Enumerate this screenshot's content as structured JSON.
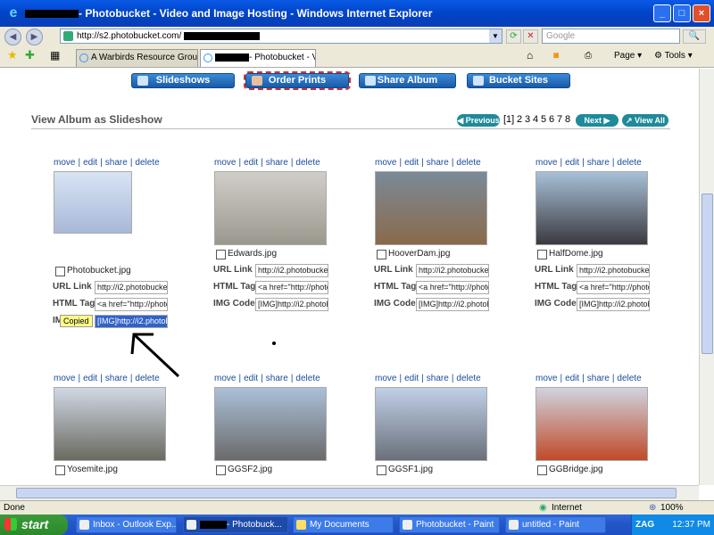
{
  "window": {
    "title": "- Photobucket - Video and Image Hosting - Windows Internet Explorer",
    "address": "http://s2.photobucket.com/",
    "search_placeholder": "Google"
  },
  "tabs": [
    {
      "label": "A Warbirds Resource Group ..."
    },
    {
      "label": "- Photobucket - V..."
    }
  ],
  "toolbar": {
    "page": "Page",
    "tools": "Tools"
  },
  "nav": {
    "slideshows": "Slideshows",
    "order_prints": "Order Prints",
    "share_album": "Share Album",
    "bucket_sites": "Bucket Sites"
  },
  "album": {
    "view_title": "View Album as Slideshow",
    "prev": "Previous",
    "current": "[1]",
    "pages": [
      "2",
      "3",
      "4",
      "5",
      "6",
      "7",
      "8"
    ],
    "next": "Next",
    "view_all": "View All"
  },
  "labels": {
    "url_link": "URL Link",
    "html_tag": "HTML Tag",
    "img_code": "IMG Code",
    "copied": "Copied",
    "img_code_partial": "IM"
  },
  "actions": {
    "move": "move",
    "edit": "edit",
    "share": "share",
    "delete": "delete",
    "sep": "|"
  },
  "photos": [
    {
      "name": "Photobucket.jpg",
      "url": "http://i2.photobucke",
      "html": "<a href=\"http://photo",
      "img": "[IMG]http://i2.photob"
    },
    {
      "name": "Edwards.jpg",
      "url": "http://i2.photobucke",
      "html": "<a href=\"http://photo",
      "img": "[IMG]http://i2.photob"
    },
    {
      "name": "HooverDam.jpg",
      "url": "http://i2.photobucke",
      "html": "<a href=\"http://photo",
      "img": "[IMG]http://i2.photob"
    },
    {
      "name": "HalfDome.jpg",
      "url": "http://i2.photobucke",
      "html": "<a href=\"http://photo",
      "img": "[IMG]http://i2.photob"
    },
    {
      "name": "Yosemite.jpg"
    },
    {
      "name": "GGSF2.jpg"
    },
    {
      "name": "GGSF1.jpg"
    },
    {
      "name": "GGBridge.jpg"
    }
  ],
  "status": {
    "left": "Done",
    "zone": "Internet",
    "zoom": "100%"
  },
  "taskbar": {
    "start": "start",
    "items": [
      "Inbox - Outlook Exp...",
      "- Photobuck...",
      "My Documents",
      "Photobucket - Paint",
      "untitled - Paint"
    ],
    "tray_text": "ZAG",
    "time": "12:37 PM"
  },
  "colors": {
    "title_blue": "#0a5ae6",
    "button_blue": "#1a5aa8",
    "link_blue": "#1a4b9a",
    "selection": "#3162c8"
  }
}
